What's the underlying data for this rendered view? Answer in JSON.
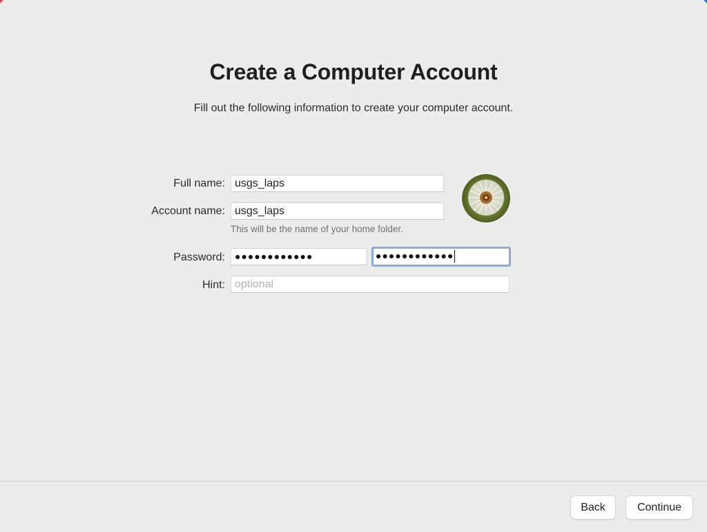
{
  "header": {
    "title": "Create a Computer Account",
    "subtitle": "Fill out the following information to create your computer account."
  },
  "form": {
    "full_name": {
      "label": "Full name:",
      "value": "usgs_laps"
    },
    "account_name": {
      "label": "Account name:",
      "value": "usgs_laps",
      "help": "This will be the name of your home folder."
    },
    "password": {
      "label": "Password:",
      "value_masked": "●●●●●●●●●●●●",
      "verify_masked": "●●●●●●●●●●●●"
    },
    "hint": {
      "label": "Hint:",
      "placeholder": "optional"
    },
    "avatar_icon": "dandelion-avatar"
  },
  "footer": {
    "back_label": "Back",
    "continue_label": "Continue"
  },
  "colors": {
    "background": "#ececec",
    "focus_ring": "#8aa9dd"
  }
}
